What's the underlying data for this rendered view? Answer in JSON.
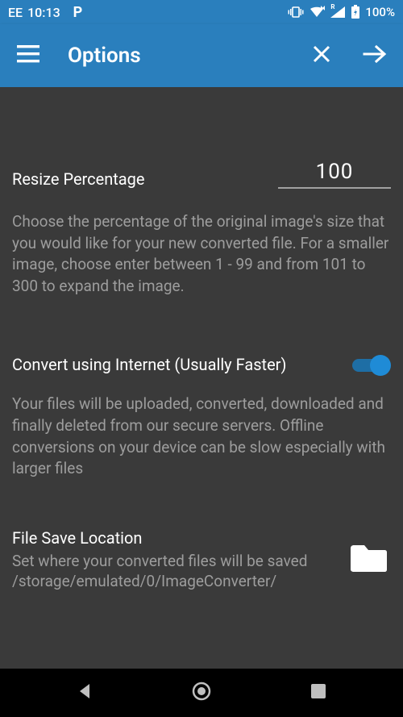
{
  "status": {
    "carrier": "EE",
    "time": "10:13",
    "battery": "100%",
    "roaming": "R"
  },
  "appbar": {
    "title": "Options"
  },
  "resize": {
    "label": "Resize Percentage",
    "value": "100",
    "helper": "Choose the percentage of the original image's size that you would like for your new converted file. For a smaller image, choose enter between 1 - 99 and from 101 to 300 to expand the image."
  },
  "internet": {
    "label": "Convert using Internet (Usually Faster)",
    "on": true,
    "helper": "Your files will be uploaded, converted, downloaded and finally deleted from our secure servers. Offline conversions on your device can be slow especially with larger files"
  },
  "save": {
    "title": "File Save Location",
    "desc": "Set where your converted files will be saved",
    "path": "/storage/emulated/0/ImageConverter/"
  },
  "colors": {
    "primary": "#2a7fbd",
    "bg": "#3a3a3a",
    "muted": "#9d9d9d"
  }
}
